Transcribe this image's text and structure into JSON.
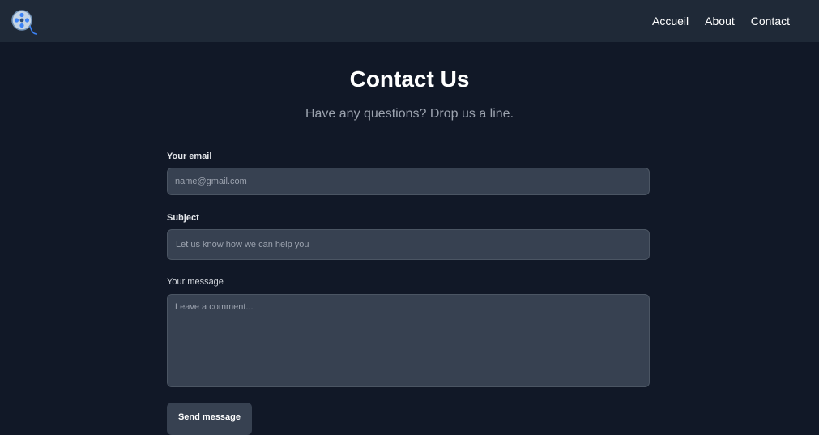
{
  "nav": {
    "logo_icon": "film-reel-icon",
    "links": [
      "Accueil",
      "About",
      "Contact"
    ]
  },
  "hero": {
    "title": "Contact Us",
    "subtitle": "Have any questions? Drop us a line."
  },
  "form": {
    "email": {
      "label": "Your email",
      "placeholder": "name@gmail.com"
    },
    "subject": {
      "label": "Subject",
      "placeholder": "Let us know how we can help you"
    },
    "message": {
      "label": "Your message",
      "placeholder": "Leave a comment..."
    },
    "submit_label": "Send message"
  },
  "colors": {
    "background": "#111827",
    "navbar": "#1f2937",
    "field": "#374151",
    "field_border": "#4b5563",
    "muted_text": "#9ca3af"
  }
}
